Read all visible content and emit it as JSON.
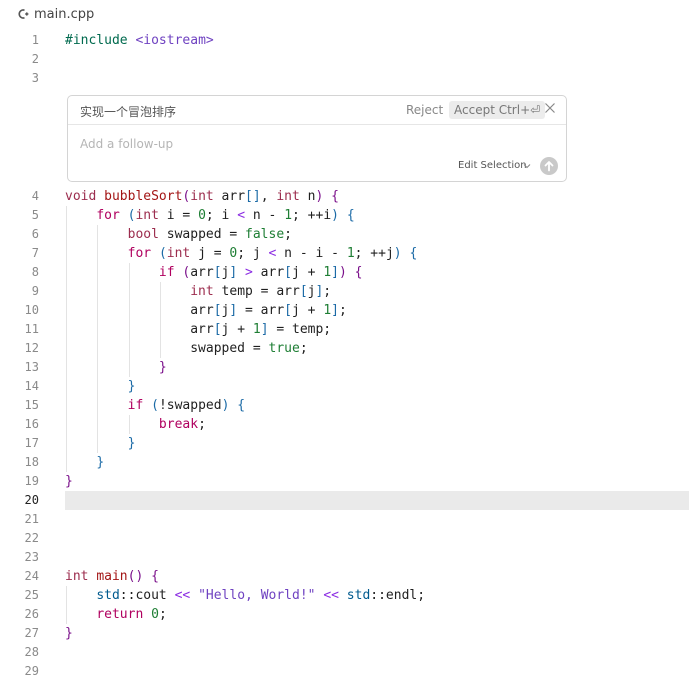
{
  "tab": {
    "icon": "c-plus-plus-file-icon",
    "filename": "main.cpp"
  },
  "current_line": 20,
  "inline_chat": {
    "prompt": "实现一个冒泡排序",
    "reject_label": "Reject",
    "accept_label": "Accept Ctrl+⏎",
    "close_icon": "close-icon",
    "followup_placeholder": "Add a follow-up",
    "edit_selection_label": "Edit Selection",
    "chevron_icon": "chevron-down-icon",
    "send_icon": "arrow-up-icon"
  },
  "lines": [
    {
      "n": "1",
      "tokens": [
        {
          "c": "t-pp",
          "t": "#include "
        },
        {
          "c": "t-inc",
          "t": "<iostream>"
        }
      ]
    },
    {
      "n": "2",
      "tokens": []
    },
    {
      "n": "3",
      "tokens": []
    },
    {
      "n": "4",
      "tokens": [
        {
          "c": "t-type",
          "t": "void"
        },
        {
          "c": "t-id",
          "t": " "
        },
        {
          "c": "t-fn",
          "t": "bubbleSort"
        },
        {
          "c": "t-br",
          "t": "("
        },
        {
          "c": "t-type",
          "t": "int"
        },
        {
          "c": "t-id",
          "t": " arr"
        },
        {
          "c": "t-br2",
          "t": "[]"
        },
        {
          "c": "t-id",
          "t": ", "
        },
        {
          "c": "t-type",
          "t": "int"
        },
        {
          "c": "t-id",
          "t": " n"
        },
        {
          "c": "t-br",
          "t": ")"
        },
        {
          "c": "t-id",
          "t": " "
        },
        {
          "c": "t-br",
          "t": "{"
        }
      ]
    },
    {
      "n": "5",
      "tokens": [
        {
          "c": "t-id",
          "t": "    "
        },
        {
          "c": "t-kw",
          "t": "for"
        },
        {
          "c": "t-id",
          "t": " "
        },
        {
          "c": "t-br2",
          "t": "("
        },
        {
          "c": "t-type",
          "t": "int"
        },
        {
          "c": "t-id",
          "t": " i = "
        },
        {
          "c": "t-num",
          "t": "0"
        },
        {
          "c": "t-id",
          "t": "; i "
        },
        {
          "c": "t-op",
          "t": "<"
        },
        {
          "c": "t-id",
          "t": " n - "
        },
        {
          "c": "t-num",
          "t": "1"
        },
        {
          "c": "t-id",
          "t": "; ++i"
        },
        {
          "c": "t-br2",
          "t": ")"
        },
        {
          "c": "t-id",
          "t": " "
        },
        {
          "c": "t-br2",
          "t": "{"
        }
      ]
    },
    {
      "n": "6",
      "tokens": [
        {
          "c": "t-id",
          "t": "        "
        },
        {
          "c": "t-type",
          "t": "bool"
        },
        {
          "c": "t-id",
          "t": " swapped = "
        },
        {
          "c": "t-bool",
          "t": "false"
        },
        {
          "c": "t-id",
          "t": ";"
        }
      ]
    },
    {
      "n": "7",
      "tokens": [
        {
          "c": "t-id",
          "t": "        "
        },
        {
          "c": "t-kw",
          "t": "for"
        },
        {
          "c": "t-id",
          "t": " "
        },
        {
          "c": "t-br2",
          "t": "("
        },
        {
          "c": "t-type",
          "t": "int"
        },
        {
          "c": "t-id",
          "t": " j = "
        },
        {
          "c": "t-num",
          "t": "0"
        },
        {
          "c": "t-id",
          "t": "; j "
        },
        {
          "c": "t-op",
          "t": "<"
        },
        {
          "c": "t-id",
          "t": " n - i - "
        },
        {
          "c": "t-num",
          "t": "1"
        },
        {
          "c": "t-id",
          "t": "; ++j"
        },
        {
          "c": "t-br2",
          "t": ")"
        },
        {
          "c": "t-id",
          "t": " "
        },
        {
          "c": "t-br2",
          "t": "{"
        }
      ]
    },
    {
      "n": "8",
      "tokens": [
        {
          "c": "t-id",
          "t": "            "
        },
        {
          "c": "t-kw",
          "t": "if"
        },
        {
          "c": "t-id",
          "t": " "
        },
        {
          "c": "t-br",
          "t": "("
        },
        {
          "c": "t-id",
          "t": "arr"
        },
        {
          "c": "t-br2",
          "t": "["
        },
        {
          "c": "t-id",
          "t": "j"
        },
        {
          "c": "t-br2",
          "t": "]"
        },
        {
          "c": "t-id",
          "t": " "
        },
        {
          "c": "t-op",
          "t": ">"
        },
        {
          "c": "t-id",
          "t": " arr"
        },
        {
          "c": "t-br2",
          "t": "["
        },
        {
          "c": "t-id",
          "t": "j + "
        },
        {
          "c": "t-num",
          "t": "1"
        },
        {
          "c": "t-br2",
          "t": "]"
        },
        {
          "c": "t-br",
          "t": ")"
        },
        {
          "c": "t-id",
          "t": " "
        },
        {
          "c": "t-br",
          "t": "{"
        }
      ]
    },
    {
      "n": "9",
      "tokens": [
        {
          "c": "t-id",
          "t": "                "
        },
        {
          "c": "t-type",
          "t": "int"
        },
        {
          "c": "t-id",
          "t": " temp = arr"
        },
        {
          "c": "t-br2",
          "t": "["
        },
        {
          "c": "t-id",
          "t": "j"
        },
        {
          "c": "t-br2",
          "t": "]"
        },
        {
          "c": "t-id",
          "t": ";"
        }
      ]
    },
    {
      "n": "10",
      "tokens": [
        {
          "c": "t-id",
          "t": "                arr"
        },
        {
          "c": "t-br2",
          "t": "["
        },
        {
          "c": "t-id",
          "t": "j"
        },
        {
          "c": "t-br2",
          "t": "]"
        },
        {
          "c": "t-id",
          "t": " = arr"
        },
        {
          "c": "t-br2",
          "t": "["
        },
        {
          "c": "t-id",
          "t": "j + "
        },
        {
          "c": "t-num",
          "t": "1"
        },
        {
          "c": "t-br2",
          "t": "]"
        },
        {
          "c": "t-id",
          "t": ";"
        }
      ]
    },
    {
      "n": "11",
      "tokens": [
        {
          "c": "t-id",
          "t": "                arr"
        },
        {
          "c": "t-br2",
          "t": "["
        },
        {
          "c": "t-id",
          "t": "j + "
        },
        {
          "c": "t-num",
          "t": "1"
        },
        {
          "c": "t-br2",
          "t": "]"
        },
        {
          "c": "t-id",
          "t": " = temp;"
        }
      ]
    },
    {
      "n": "12",
      "tokens": [
        {
          "c": "t-id",
          "t": "                swapped = "
        },
        {
          "c": "t-bool",
          "t": "true"
        },
        {
          "c": "t-id",
          "t": ";"
        }
      ]
    },
    {
      "n": "13",
      "tokens": [
        {
          "c": "t-id",
          "t": "            "
        },
        {
          "c": "t-br",
          "t": "}"
        }
      ]
    },
    {
      "n": "14",
      "tokens": [
        {
          "c": "t-id",
          "t": "        "
        },
        {
          "c": "t-br2",
          "t": "}"
        }
      ]
    },
    {
      "n": "15",
      "tokens": [
        {
          "c": "t-id",
          "t": "        "
        },
        {
          "c": "t-kw",
          "t": "if"
        },
        {
          "c": "t-id",
          "t": " "
        },
        {
          "c": "t-br2",
          "t": "("
        },
        {
          "c": "t-id",
          "t": "!swapped"
        },
        {
          "c": "t-br2",
          "t": ")"
        },
        {
          "c": "t-id",
          "t": " "
        },
        {
          "c": "t-br2",
          "t": "{"
        }
      ]
    },
    {
      "n": "16",
      "tokens": [
        {
          "c": "t-id",
          "t": "            "
        },
        {
          "c": "t-kw",
          "t": "break"
        },
        {
          "c": "t-id",
          "t": ";"
        }
      ]
    },
    {
      "n": "17",
      "tokens": [
        {
          "c": "t-id",
          "t": "        "
        },
        {
          "c": "t-br2",
          "t": "}"
        }
      ]
    },
    {
      "n": "18",
      "tokens": [
        {
          "c": "t-id",
          "t": "    "
        },
        {
          "c": "t-br2",
          "t": "}"
        }
      ]
    },
    {
      "n": "19",
      "tokens": [
        {
          "c": "t-br",
          "t": "}"
        }
      ]
    },
    {
      "n": "20",
      "tokens": []
    },
    {
      "n": "21",
      "tokens": []
    },
    {
      "n": "22",
      "tokens": []
    },
    {
      "n": "23",
      "tokens": []
    },
    {
      "n": "24",
      "tokens": [
        {
          "c": "t-type",
          "t": "int"
        },
        {
          "c": "t-id",
          "t": " "
        },
        {
          "c": "t-fn",
          "t": "main"
        },
        {
          "c": "t-br",
          "t": "()"
        },
        {
          "c": "t-id",
          "t": " "
        },
        {
          "c": "t-br",
          "t": "{"
        }
      ]
    },
    {
      "n": "25",
      "tokens": [
        {
          "c": "t-id",
          "t": "    "
        },
        {
          "c": "t-ns",
          "t": "std"
        },
        {
          "c": "t-id",
          "t": "::cout "
        },
        {
          "c": "t-op",
          "t": "<<"
        },
        {
          "c": "t-id",
          "t": " "
        },
        {
          "c": "t-str",
          "t": "\"Hello, World!\""
        },
        {
          "c": "t-id",
          "t": " "
        },
        {
          "c": "t-op",
          "t": "<<"
        },
        {
          "c": "t-id",
          "t": " "
        },
        {
          "c": "t-ns",
          "t": "std"
        },
        {
          "c": "t-id",
          "t": "::endl;"
        }
      ]
    },
    {
      "n": "26",
      "tokens": [
        {
          "c": "t-id",
          "t": "    "
        },
        {
          "c": "t-kw",
          "t": "return"
        },
        {
          "c": "t-id",
          "t": " "
        },
        {
          "c": "t-num",
          "t": "0"
        },
        {
          "c": "t-id",
          "t": ";"
        }
      ]
    },
    {
      "n": "27",
      "tokens": [
        {
          "c": "t-br",
          "t": "}"
        }
      ]
    },
    {
      "n": "28",
      "tokens": []
    },
    {
      "n": "29",
      "tokens": []
    }
  ]
}
